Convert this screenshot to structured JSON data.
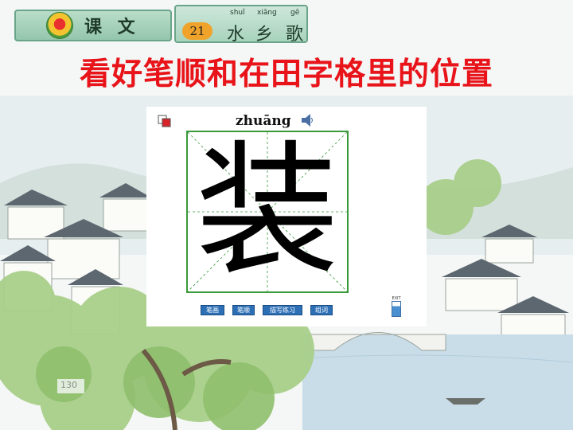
{
  "header": {
    "lesson_label": "课 文",
    "lesson_number": "21",
    "title_pinyin": [
      "shuǐ",
      "xiāng",
      "gē"
    ],
    "title_chars": [
      "水",
      "乡",
      "歌"
    ]
  },
  "instruction": "看好笔顺和在田字格里的位置",
  "writer": {
    "pinyin": "zhuāng",
    "character": "装",
    "buttons": [
      "笔画",
      "笔顺",
      "描写练习",
      "组词"
    ],
    "meter_label": "EXIT"
  },
  "scene": {
    "page_number": "130"
  },
  "colors": {
    "instruction": "#e8141a",
    "grid_border": "#3a9a3a",
    "button": "#2c6fb5"
  },
  "icons": [
    "flower-icon",
    "speaker-icon",
    "flag-icon",
    "progress-meter-icon"
  ]
}
